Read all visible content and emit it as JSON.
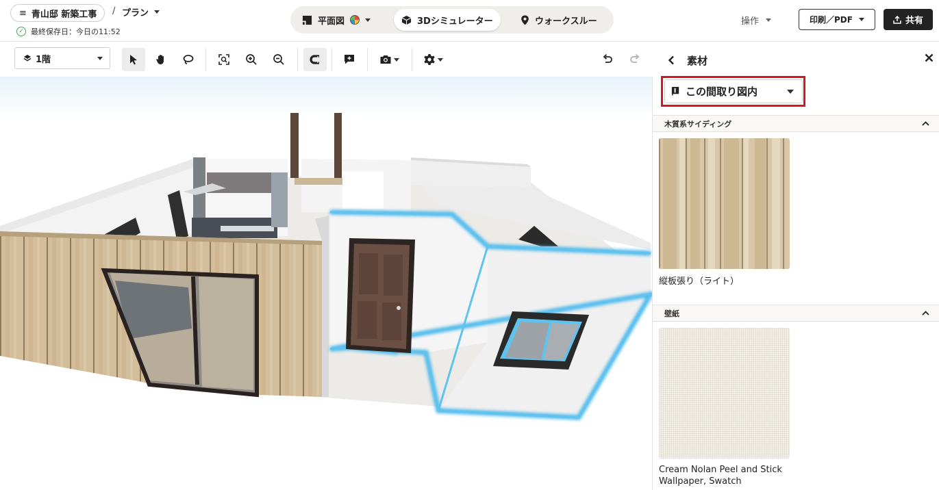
{
  "header": {
    "project_name": "青山邸 新築工事",
    "breadcrumb_separator": "/",
    "plan_label": "プラン",
    "saved_text": "最終保存日：今日の11:52",
    "modes": [
      {
        "label": "平面図",
        "active": false
      },
      {
        "label": "3Dシミュレーター",
        "active": true
      },
      {
        "label": "ウォークスルー",
        "active": false
      }
    ],
    "operations_label": "操作",
    "print_label": "印刷／PDF",
    "share_label": "共有"
  },
  "toolbar": {
    "floor_label": "1階",
    "tools": [
      "select-tool",
      "pan-tool",
      "lasso-tool",
      "fit-view",
      "zoom-in",
      "zoom-out",
      "magnet-snap",
      "add-annotation",
      "camera",
      "settings",
      "undo",
      "redo"
    ],
    "active_tools": [
      "select-tool",
      "magnet-snap"
    ]
  },
  "panel": {
    "title": "素材",
    "scope_label": "この間取り図内",
    "sections": [
      {
        "title": "木質系サイディング",
        "material": "縦板張り（ライト）"
      },
      {
        "title": "壁紙",
        "material": "Cream Nolan Peel and Stick Wallpaper, Swatch"
      }
    ]
  },
  "colors": {
    "accent_highlight": "#d9161f",
    "selection_glow": "#49b6ea",
    "save_ok": "#3aa757",
    "share_bg": "#222222"
  }
}
